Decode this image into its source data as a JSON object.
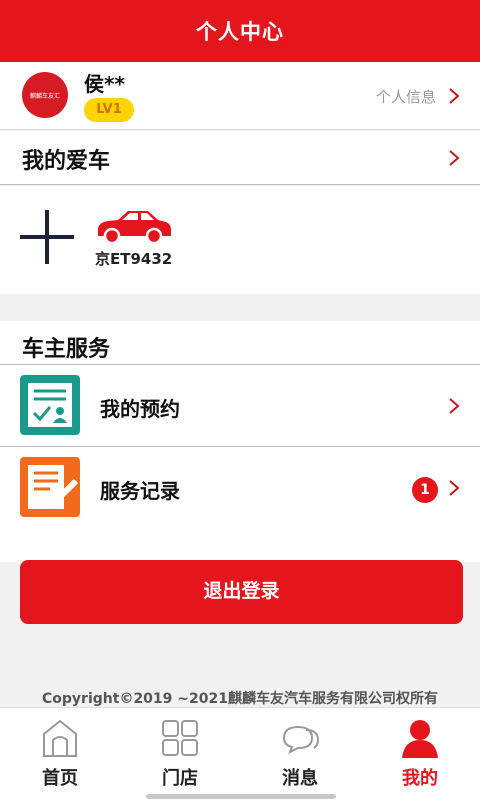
{
  "header": {
    "title": "个人中心"
  },
  "profile": {
    "avatar_text": "麒麟车友汇",
    "username": "侯**",
    "level": "LV1",
    "info_link": "个人信息"
  },
  "my_car": {
    "title": "我的爱车",
    "plate": "京ET9432"
  },
  "services": {
    "title": "车主服务",
    "items": [
      {
        "label": "我的预约",
        "icon": "appointment-icon"
      },
      {
        "label": "服务记录",
        "icon": "service-record-icon",
        "badge": "1"
      }
    ]
  },
  "logout_label": "退出登录",
  "copyright": "Copyright©2019 ~2021麒麟车友汽车服务有限公司权所有",
  "tabs": [
    {
      "label": "首页",
      "icon": "home-icon"
    },
    {
      "label": "门店",
      "icon": "store-grid-icon"
    },
    {
      "label": "消息",
      "icon": "message-icon"
    },
    {
      "label": "我的",
      "icon": "user-icon",
      "active": true
    }
  ],
  "colors": {
    "primary": "#e4161d",
    "badge_yellow": "#ffd400",
    "teal": "#1a9a8a",
    "orange": "#f26a1b"
  }
}
